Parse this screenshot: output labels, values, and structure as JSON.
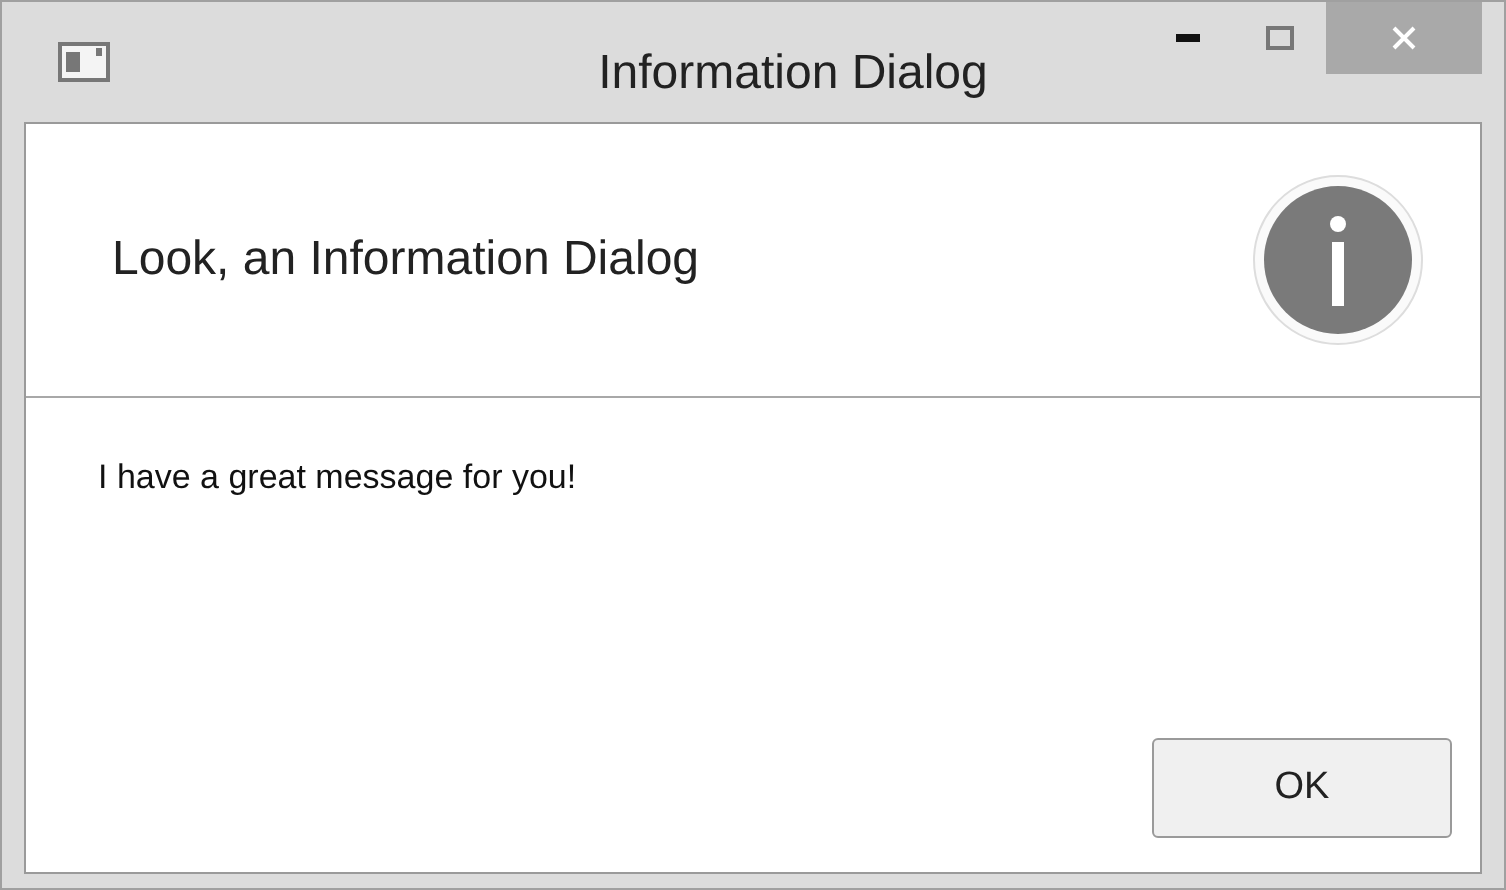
{
  "window": {
    "title": "Information Dialog"
  },
  "header": {
    "text": "Look, an Information Dialog"
  },
  "message": "I have a great message for you!",
  "buttons": [
    {
      "label": "OK"
    }
  ]
}
